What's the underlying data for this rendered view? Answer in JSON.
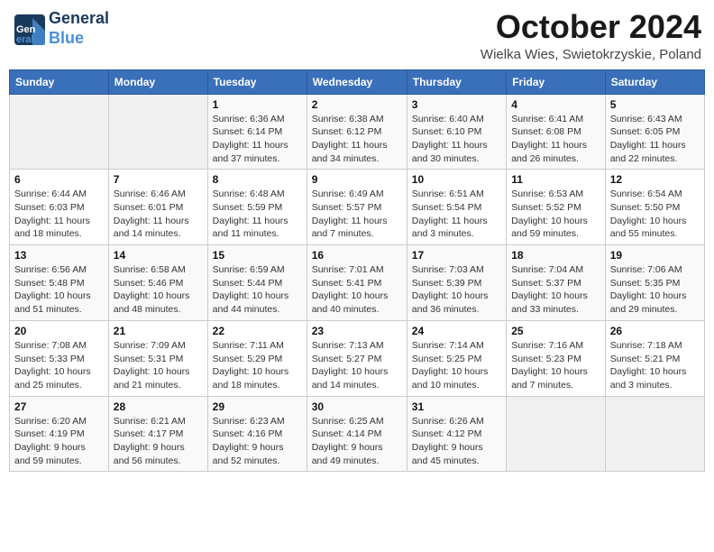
{
  "header": {
    "logo": {
      "line1": "General",
      "line2": "Blue"
    },
    "month": "October 2024",
    "location": "Wielka Wies, Swietokrzyskie, Poland"
  },
  "weekdays": [
    "Sunday",
    "Monday",
    "Tuesday",
    "Wednesday",
    "Thursday",
    "Friday",
    "Saturday"
  ],
  "weeks": [
    [
      {
        "day": "",
        "info": ""
      },
      {
        "day": "",
        "info": ""
      },
      {
        "day": "1",
        "info": "Sunrise: 6:36 AM\nSunset: 6:14 PM\nDaylight: 11 hours\nand 37 minutes."
      },
      {
        "day": "2",
        "info": "Sunrise: 6:38 AM\nSunset: 6:12 PM\nDaylight: 11 hours\nand 34 minutes."
      },
      {
        "day": "3",
        "info": "Sunrise: 6:40 AM\nSunset: 6:10 PM\nDaylight: 11 hours\nand 30 minutes."
      },
      {
        "day": "4",
        "info": "Sunrise: 6:41 AM\nSunset: 6:08 PM\nDaylight: 11 hours\nand 26 minutes."
      },
      {
        "day": "5",
        "info": "Sunrise: 6:43 AM\nSunset: 6:05 PM\nDaylight: 11 hours\nand 22 minutes."
      }
    ],
    [
      {
        "day": "6",
        "info": "Sunrise: 6:44 AM\nSunset: 6:03 PM\nDaylight: 11 hours\nand 18 minutes."
      },
      {
        "day": "7",
        "info": "Sunrise: 6:46 AM\nSunset: 6:01 PM\nDaylight: 11 hours\nand 14 minutes."
      },
      {
        "day": "8",
        "info": "Sunrise: 6:48 AM\nSunset: 5:59 PM\nDaylight: 11 hours\nand 11 minutes."
      },
      {
        "day": "9",
        "info": "Sunrise: 6:49 AM\nSunset: 5:57 PM\nDaylight: 11 hours\nand 7 minutes."
      },
      {
        "day": "10",
        "info": "Sunrise: 6:51 AM\nSunset: 5:54 PM\nDaylight: 11 hours\nand 3 minutes."
      },
      {
        "day": "11",
        "info": "Sunrise: 6:53 AM\nSunset: 5:52 PM\nDaylight: 10 hours\nand 59 minutes."
      },
      {
        "day": "12",
        "info": "Sunrise: 6:54 AM\nSunset: 5:50 PM\nDaylight: 10 hours\nand 55 minutes."
      }
    ],
    [
      {
        "day": "13",
        "info": "Sunrise: 6:56 AM\nSunset: 5:48 PM\nDaylight: 10 hours\nand 51 minutes."
      },
      {
        "day": "14",
        "info": "Sunrise: 6:58 AM\nSunset: 5:46 PM\nDaylight: 10 hours\nand 48 minutes."
      },
      {
        "day": "15",
        "info": "Sunrise: 6:59 AM\nSunset: 5:44 PM\nDaylight: 10 hours\nand 44 minutes."
      },
      {
        "day": "16",
        "info": "Sunrise: 7:01 AM\nSunset: 5:41 PM\nDaylight: 10 hours\nand 40 minutes."
      },
      {
        "day": "17",
        "info": "Sunrise: 7:03 AM\nSunset: 5:39 PM\nDaylight: 10 hours\nand 36 minutes."
      },
      {
        "day": "18",
        "info": "Sunrise: 7:04 AM\nSunset: 5:37 PM\nDaylight: 10 hours\nand 33 minutes."
      },
      {
        "day": "19",
        "info": "Sunrise: 7:06 AM\nSunset: 5:35 PM\nDaylight: 10 hours\nand 29 minutes."
      }
    ],
    [
      {
        "day": "20",
        "info": "Sunrise: 7:08 AM\nSunset: 5:33 PM\nDaylight: 10 hours\nand 25 minutes."
      },
      {
        "day": "21",
        "info": "Sunrise: 7:09 AM\nSunset: 5:31 PM\nDaylight: 10 hours\nand 21 minutes."
      },
      {
        "day": "22",
        "info": "Sunrise: 7:11 AM\nSunset: 5:29 PM\nDaylight: 10 hours\nand 18 minutes."
      },
      {
        "day": "23",
        "info": "Sunrise: 7:13 AM\nSunset: 5:27 PM\nDaylight: 10 hours\nand 14 minutes."
      },
      {
        "day": "24",
        "info": "Sunrise: 7:14 AM\nSunset: 5:25 PM\nDaylight: 10 hours\nand 10 minutes."
      },
      {
        "day": "25",
        "info": "Sunrise: 7:16 AM\nSunset: 5:23 PM\nDaylight: 10 hours\nand 7 minutes."
      },
      {
        "day": "26",
        "info": "Sunrise: 7:18 AM\nSunset: 5:21 PM\nDaylight: 10 hours\nand 3 minutes."
      }
    ],
    [
      {
        "day": "27",
        "info": "Sunrise: 6:20 AM\nSunset: 4:19 PM\nDaylight: 9 hours\nand 59 minutes."
      },
      {
        "day": "28",
        "info": "Sunrise: 6:21 AM\nSunset: 4:17 PM\nDaylight: 9 hours\nand 56 minutes."
      },
      {
        "day": "29",
        "info": "Sunrise: 6:23 AM\nSunset: 4:16 PM\nDaylight: 9 hours\nand 52 minutes."
      },
      {
        "day": "30",
        "info": "Sunrise: 6:25 AM\nSunset: 4:14 PM\nDaylight: 9 hours\nand 49 minutes."
      },
      {
        "day": "31",
        "info": "Sunrise: 6:26 AM\nSunset: 4:12 PM\nDaylight: 9 hours\nand 45 minutes."
      },
      {
        "day": "",
        "info": ""
      },
      {
        "day": "",
        "info": ""
      }
    ]
  ]
}
